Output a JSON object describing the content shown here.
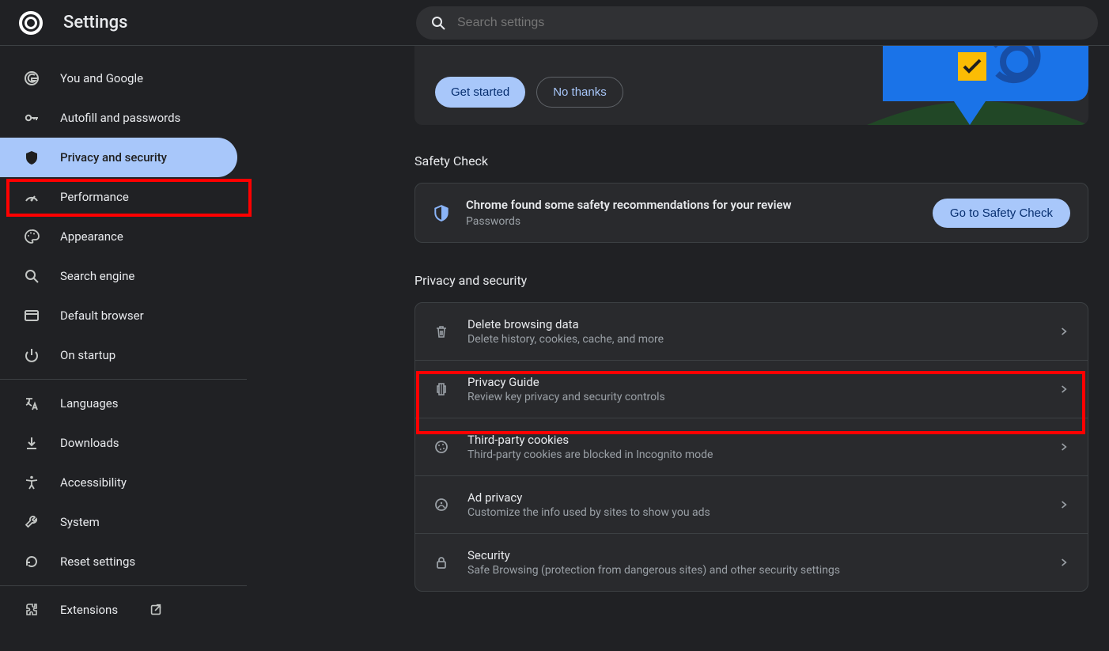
{
  "app": {
    "title": "Settings"
  },
  "search": {
    "placeholder": "Search settings"
  },
  "sidebar": {
    "groups": [
      {
        "items": [
          {
            "id": "you-and-google",
            "label": "You and Google",
            "icon": "google"
          },
          {
            "id": "autofill-passwords",
            "label": "Autofill and passwords",
            "icon": "key"
          },
          {
            "id": "privacy-security",
            "label": "Privacy and security",
            "icon": "shield",
            "active": true
          },
          {
            "id": "performance",
            "label": "Performance",
            "icon": "speed"
          },
          {
            "id": "appearance",
            "label": "Appearance",
            "icon": "palette"
          },
          {
            "id": "search-engine",
            "label": "Search engine",
            "icon": "search"
          },
          {
            "id": "default-browser",
            "label": "Default browser",
            "icon": "browser"
          },
          {
            "id": "on-startup",
            "label": "On startup",
            "icon": "power"
          }
        ]
      },
      {
        "items": [
          {
            "id": "languages",
            "label": "Languages",
            "icon": "translate"
          },
          {
            "id": "downloads",
            "label": "Downloads",
            "icon": "download"
          },
          {
            "id": "accessibility",
            "label": "Accessibility",
            "icon": "accessibility"
          },
          {
            "id": "system",
            "label": "System",
            "icon": "wrench"
          },
          {
            "id": "reset",
            "label": "Reset settings",
            "icon": "reset"
          }
        ]
      },
      {
        "items": [
          {
            "id": "extensions",
            "label": "Extensions",
            "icon": "puzzle",
            "external": true
          }
        ]
      }
    ]
  },
  "promo": {
    "primary": "Get started",
    "secondary": "No thanks"
  },
  "safety_check": {
    "section_title": "Safety Check",
    "title": "Chrome found some safety recommendations for your review",
    "subtitle": "Passwords",
    "button": "Go to Safety Check"
  },
  "privacy": {
    "section_title": "Privacy and security",
    "rows": [
      {
        "id": "delete-browsing-data",
        "icon": "trash",
        "title": "Delete browsing data",
        "sub": "Delete history, cookies, cache, and more"
      },
      {
        "id": "privacy-guide",
        "icon": "guide",
        "title": "Privacy Guide",
        "sub": "Review key privacy and security controls"
      },
      {
        "id": "third-party-cookies",
        "icon": "cookie",
        "title": "Third-party cookies",
        "sub": "Third-party cookies are blocked in Incognito mode"
      },
      {
        "id": "ad-privacy",
        "icon": "ads",
        "title": "Ad privacy",
        "sub": "Customize the info used by sites to show you ads"
      },
      {
        "id": "security",
        "icon": "lock",
        "title": "Security",
        "sub": "Safe Browsing (protection from dangerous sites) and other security settings"
      }
    ]
  },
  "colors": {
    "accent": "#a8c7fa",
    "bg": "#202124",
    "card": "#292a2d",
    "red": "#ff0000"
  }
}
